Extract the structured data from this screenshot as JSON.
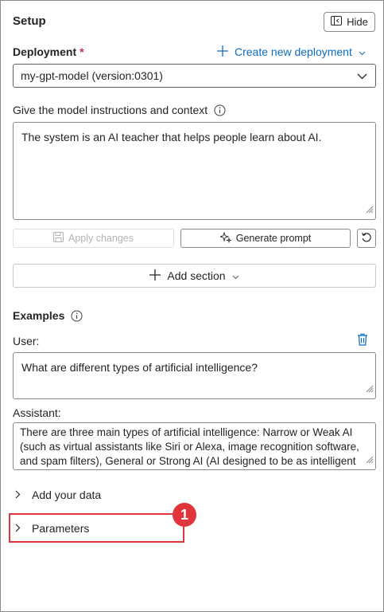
{
  "panel": {
    "title": "Setup",
    "hide_label": "Hide"
  },
  "deployment": {
    "label": "Deployment",
    "required_mark": "*",
    "create_link": "Create new deployment",
    "selected": "my-gpt-model (version:0301)"
  },
  "instructions": {
    "label": "Give the model instructions and context",
    "value": "The system is an AI teacher that helps people learn about AI."
  },
  "actions": {
    "apply_changes": "Apply changes",
    "generate_prompt": "Generate prompt",
    "add_section": "Add section"
  },
  "examples": {
    "label": "Examples",
    "user_label": "User:",
    "user_value": "What are different types of artificial intelligence?",
    "assistant_label": "Assistant:",
    "assistant_value": "There are three main types of artificial intelligence: Narrow or Weak AI (such as virtual assistants like Siri or Alexa, image recognition software, and spam filters), General or Strong AI (AI designed to be as intelligent as a human being. This type of AI does not currently exist and is purely theoretical)"
  },
  "sections": {
    "add_your_data": "Add your data",
    "parameters": "Parameters"
  },
  "annotation": {
    "badge": "1"
  },
  "colors": {
    "accent": "#0f6cbd",
    "required": "#c4314b",
    "highlight": "#e0353a"
  }
}
